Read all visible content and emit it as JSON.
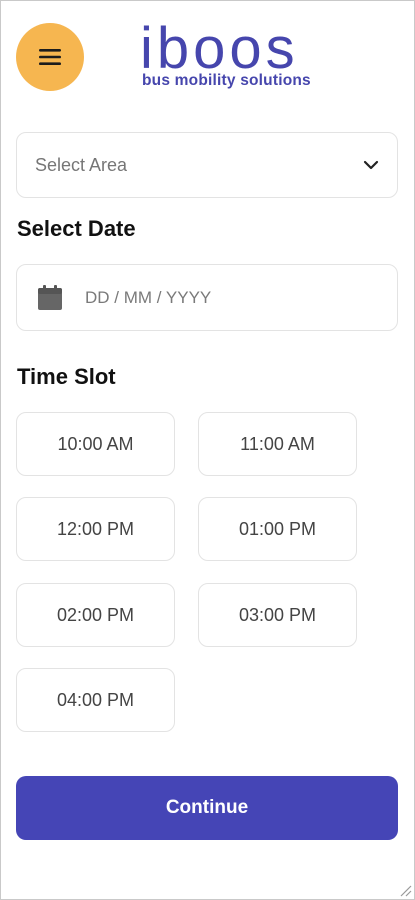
{
  "header": {
    "menu_icon": "hamburger-menu-icon",
    "logo_text": "iboos",
    "logo_tagline": "bus mobility solutions",
    "menu_button_color": "#f6b650",
    "brand_color": "#4646ad"
  },
  "area": {
    "placeholder": "Select Area",
    "icon": "chevron-down-icon"
  },
  "date": {
    "title": "Select Date",
    "placeholder": "DD / MM / YYYY",
    "icon": "calendar-icon"
  },
  "time": {
    "title": "Time Slot",
    "slots": [
      "10:00 AM",
      "11:00 AM",
      "12:00 PM",
      "01:00 PM",
      "02:00 PM",
      "03:00 PM",
      "04:00 PM"
    ]
  },
  "actions": {
    "continue_label": "Continue",
    "continue_color": "#4545b6"
  }
}
